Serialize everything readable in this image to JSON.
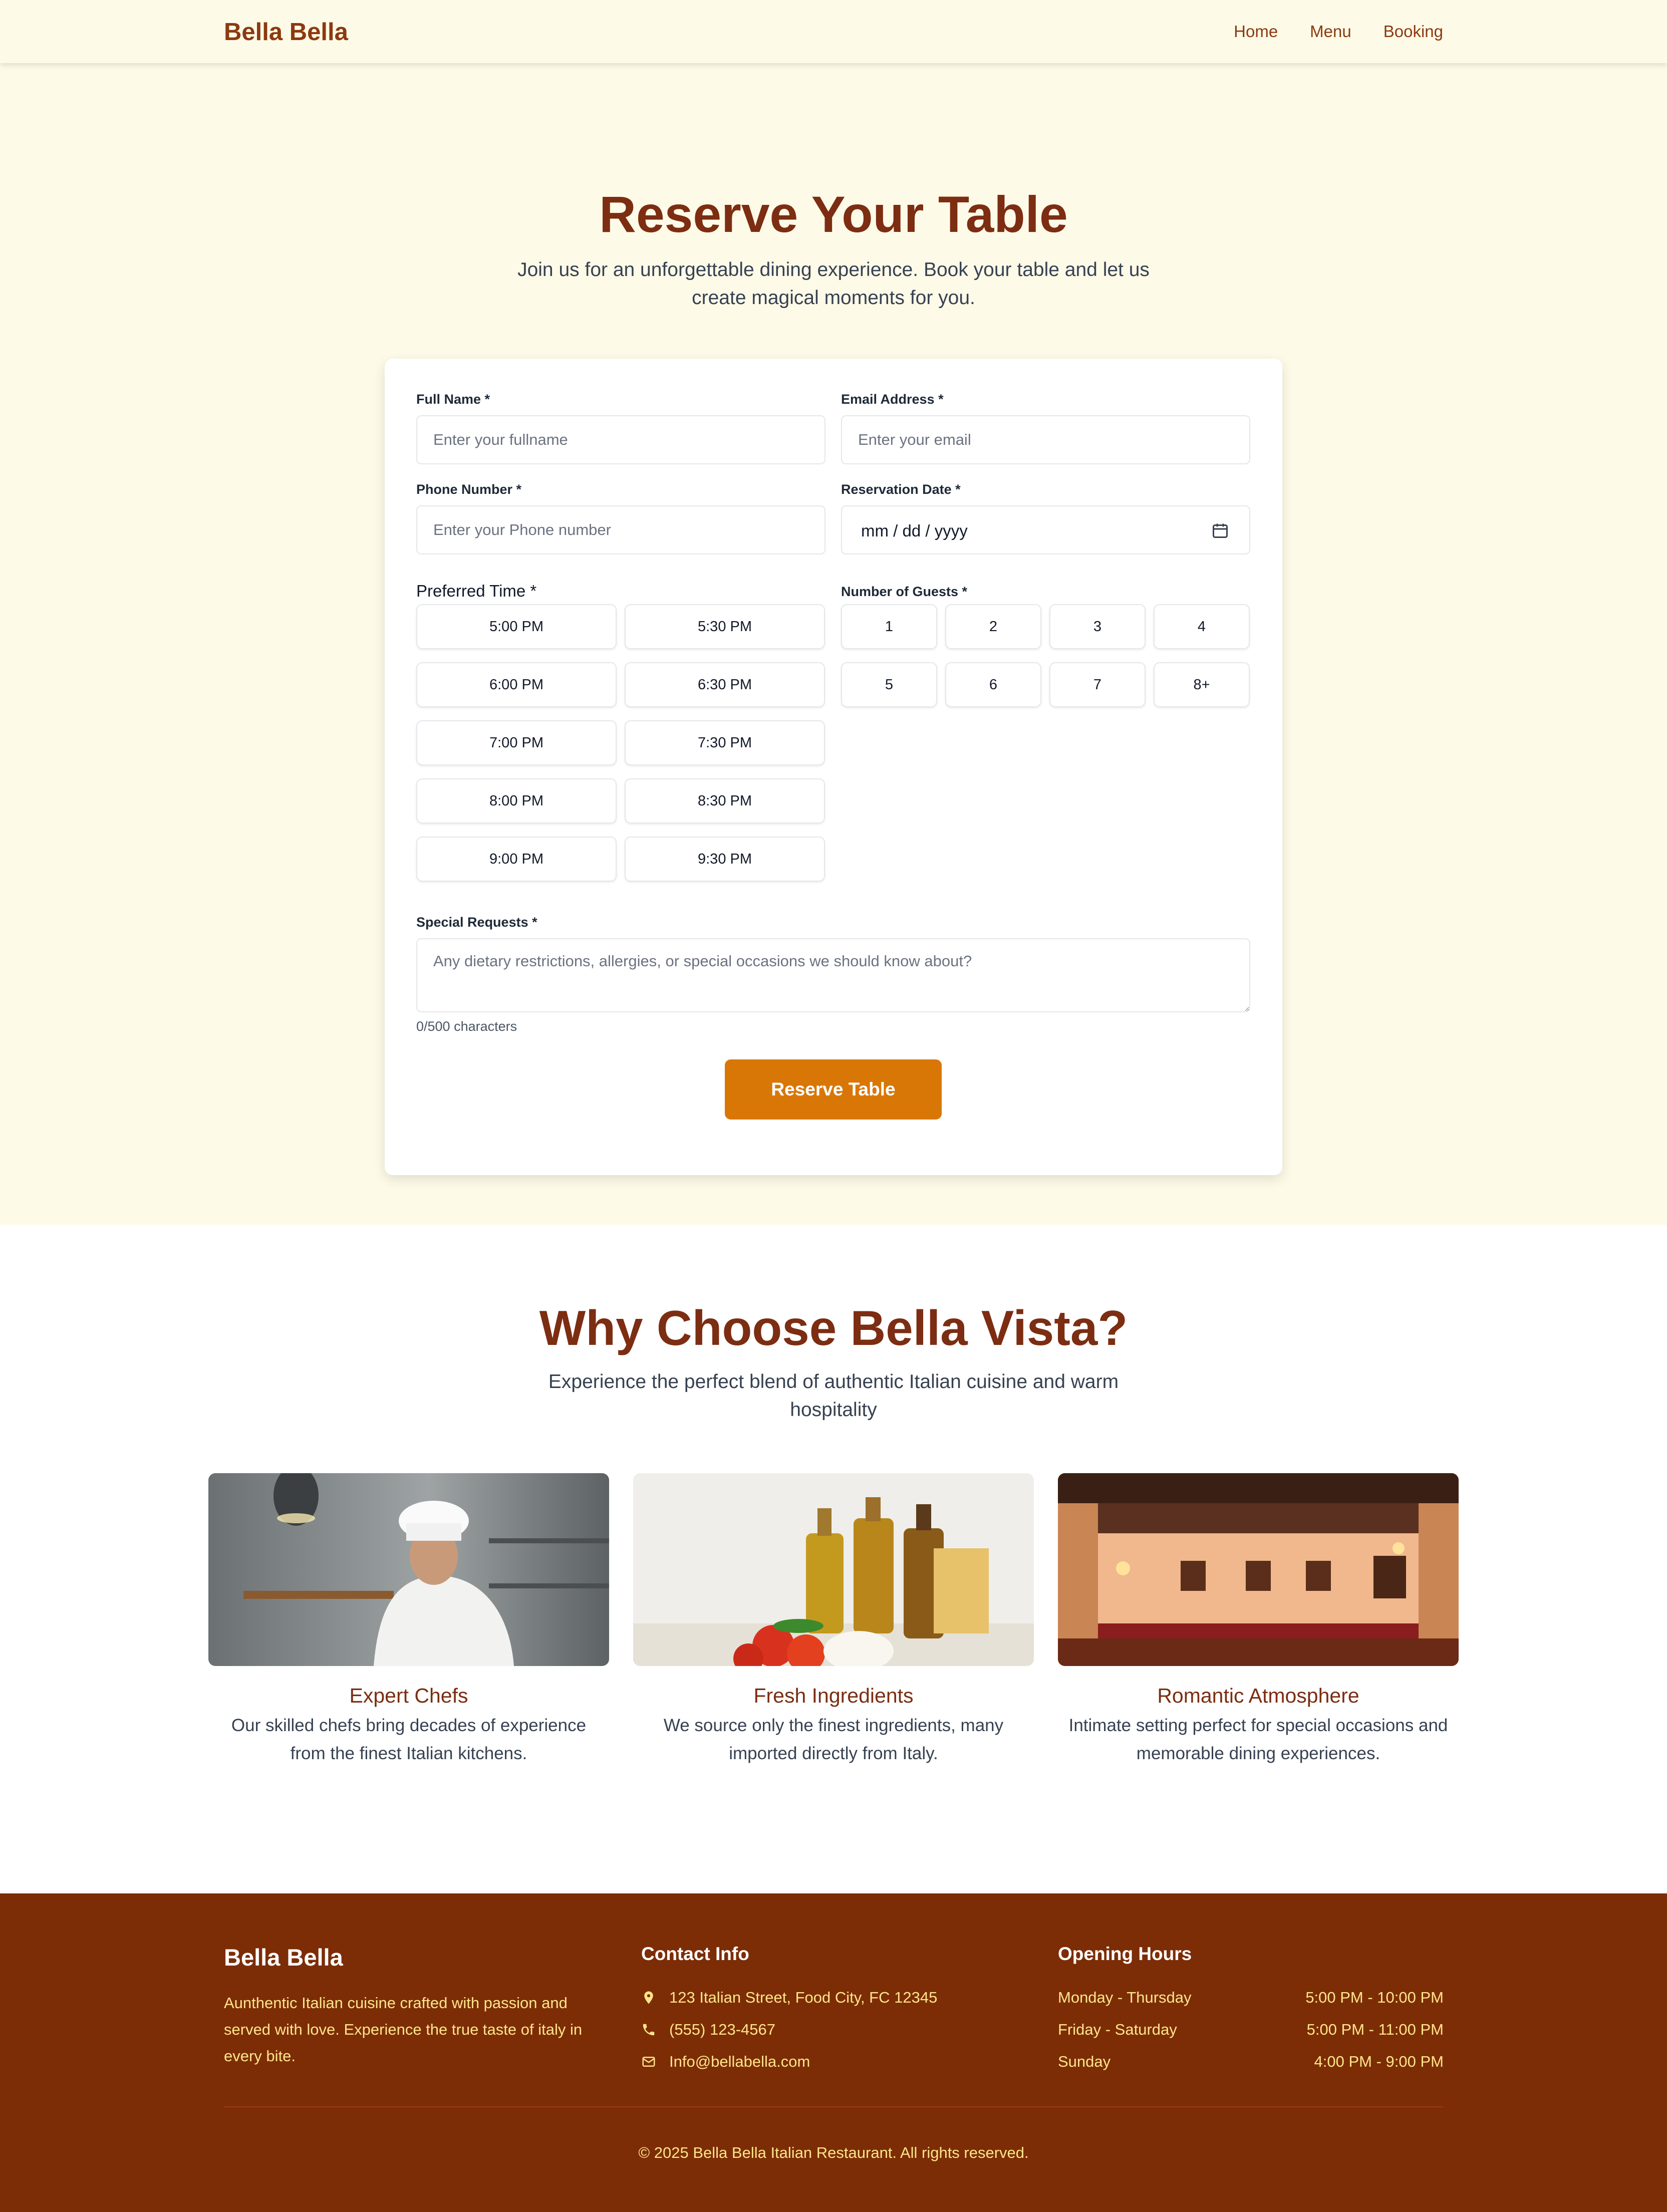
{
  "nav": {
    "brand": "Bella Bella",
    "links": [
      "Home",
      "Menu",
      "Booking"
    ]
  },
  "hero": {
    "title": "Reserve Your Table",
    "subtitle": "Join us for an unforgettable dining experience. Book your table and let us create magical moments for you."
  },
  "form": {
    "full_name": {
      "label": "Full Name *",
      "placeholder": "Enter your fullname",
      "value": ""
    },
    "email": {
      "label": "Email Address *",
      "placeholder": "Enter your email",
      "value": ""
    },
    "phone": {
      "label": "Phone Number *",
      "placeholder": "Enter your Phone number",
      "value": ""
    },
    "date": {
      "label": "Reservation Date *",
      "value": "mm / dd / yyyy",
      "icon": "calendar-icon"
    },
    "time": {
      "label": "Preferred Time *",
      "options": [
        "5:00 PM",
        "5:30 PM",
        "6:00 PM",
        "6:30 PM",
        "7:00 PM",
        "7:30 PM",
        "8:00 PM",
        "8:30 PM",
        "9:00 PM",
        "9:30 PM"
      ]
    },
    "guests": {
      "label": "Number of Guests *",
      "options": [
        "1",
        "2",
        "3",
        "4",
        "5",
        "6",
        "7",
        "8+"
      ]
    },
    "requests": {
      "label": "Special Requests *",
      "placeholder": "Any dietary restrictions, allergies, or special occasions we should know about?",
      "value": "",
      "counter": "0/500 characters"
    },
    "submit_label": "Reserve Table"
  },
  "why": {
    "title": "Why Choose Bella Vista?",
    "subtitle": "Experience the perfect blend of authentic Italian cuisine and warm hospitality",
    "features": [
      {
        "title": "Expert Chefs",
        "description": "Our skilled chefs bring decades of experience from the finest Italian kitchens."
      },
      {
        "title": "Fresh Ingredients",
        "description": "We source only the finest ingredients, many imported directly from Italy."
      },
      {
        "title": "Romantic Atmosphere",
        "description": "Intimate setting perfect for special occasions and memorable dining experiences."
      }
    ]
  },
  "footer": {
    "brand": "Bella Bella",
    "about": "Aunthentic Italian cuisine crafted with passion and served with love. Experience the true taste of italy in every bite.",
    "contact": {
      "heading": "Contact Info",
      "address": "123 Italian Street, Food City, FC 12345",
      "phone": "(555) 123-4567",
      "email": "Info@bellabella.com"
    },
    "hours": {
      "heading": "Opening Hours",
      "rows": [
        {
          "day": "Monday - Thursday",
          "time": "5:00 PM - 10:00 PM"
        },
        {
          "day": "Friday - Saturday",
          "time": "5:00 PM - 11:00 PM"
        },
        {
          "day": "Sunday",
          "time": "4:00 PM - 9:00 PM"
        }
      ]
    },
    "copyright": "© 2025 Bella Bella Italian Restaurant. All rights reserved."
  },
  "colors": {
    "brand_brown": "#7c2d12",
    "accent_orange": "#d97706",
    "cream": "#fefae8",
    "footer_bg": "#7c2d06",
    "footer_text": "#fde68a"
  }
}
